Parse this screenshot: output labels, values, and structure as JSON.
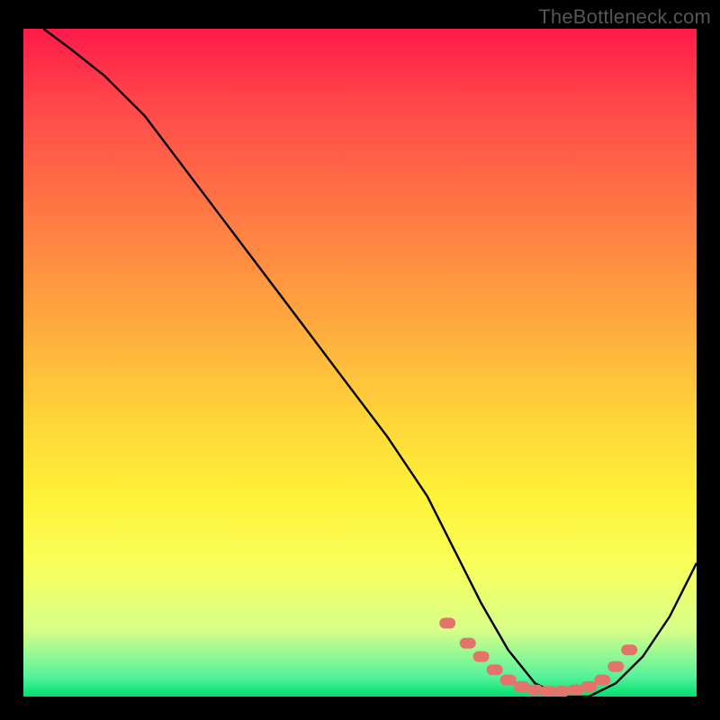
{
  "attribution": "TheBottleneck.com",
  "chart_data": {
    "type": "line",
    "title": "",
    "xlabel": "",
    "ylabel": "",
    "xlim": [
      0,
      100
    ],
    "ylim": [
      0,
      100
    ],
    "series": [
      {
        "name": "curve",
        "x": [
          3,
          7,
          12,
          18,
          24,
          30,
          36,
          42,
          48,
          54,
          60,
          64,
          68,
          72,
          76,
          80,
          84,
          88,
          92,
          96,
          100
        ],
        "y": [
          100,
          97,
          93,
          87,
          79,
          71,
          63,
          55,
          47,
          39,
          30,
          22,
          14,
          7,
          2,
          0,
          0,
          2,
          6,
          12,
          20
        ]
      }
    ],
    "markers": {
      "name": "highlight-band",
      "color": "#e4746b",
      "x": [
        63,
        66,
        68,
        70,
        72,
        74,
        76,
        78,
        80,
        82,
        84,
        86,
        88,
        90
      ],
      "y": [
        11,
        8,
        6,
        4,
        2.5,
        1.5,
        1,
        0.8,
        0.8,
        1,
        1.5,
        2.5,
        4.5,
        7
      ]
    },
    "gradient_stops": [
      {
        "pos": 0.0,
        "color": "#ff1a4a"
      },
      {
        "pos": 0.12,
        "color": "#ff4a4a"
      },
      {
        "pos": 0.28,
        "color": "#ff7a44"
      },
      {
        "pos": 0.44,
        "color": "#ffa93e"
      },
      {
        "pos": 0.58,
        "color": "#ffd43a"
      },
      {
        "pos": 0.7,
        "color": "#fff238"
      },
      {
        "pos": 0.8,
        "color": "#f9ff5a"
      },
      {
        "pos": 0.9,
        "color": "#d8ff8a"
      },
      {
        "pos": 0.97,
        "color": "#57f29a"
      },
      {
        "pos": 1.0,
        "color": "#00e070"
      }
    ]
  }
}
